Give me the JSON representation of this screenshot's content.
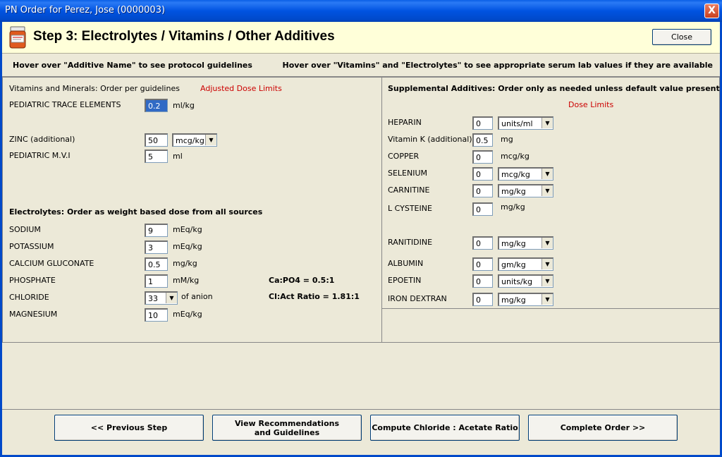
{
  "window": {
    "title": "PN Order for Perez, Jose (0000003)",
    "close_glyph": "X"
  },
  "header": {
    "step_title": "Step 3: Electrolytes / Vitamins / Other Additives",
    "close_label": "Close"
  },
  "hints": {
    "left": "Hover over \"Additive Name\" to see protocol guidelines",
    "right": "Hover over \"Vitamins\" and \"Electrolytes\" to see appropriate serum lab values if they are available"
  },
  "vitamins": {
    "heading": "Vitamins and Minerals: Order per guidelines",
    "limits_label": "Adjusted Dose Limits",
    "items": [
      {
        "name": "PEDIATRIC TRACE ELEMENTS",
        "value": "0.2",
        "unit": "ml/kg"
      },
      {
        "name": "ZINC (additional)",
        "value": "50",
        "unit": "mcg/kg"
      },
      {
        "name": "PEDIATRIC M.V.I",
        "value": "5",
        "unit": "ml"
      }
    ]
  },
  "electrolytes": {
    "heading": "Electrolytes: Order as weight based dose from all sources",
    "items": [
      {
        "name": "SODIUM",
        "value": "9",
        "unit": "mEq/kg"
      },
      {
        "name": "POTASSIUM",
        "value": "3",
        "unit": "mEq/kg"
      },
      {
        "name": "CALCIUM GLUCONATE",
        "value": "0.5",
        "unit": "mg/kg"
      },
      {
        "name": "PHOSPHATE",
        "value": "1",
        "unit": "mM/kg"
      },
      {
        "name": "CHLORIDE",
        "value": "33",
        "unit": "of anion"
      },
      {
        "name": "MAGNESIUM",
        "value": "10",
        "unit": "mEq/kg"
      }
    ],
    "ca_po4": "Ca:PO4 = 0.5:1",
    "cl_act": "Cl:Act Ratio = 1.81:1"
  },
  "supplemental": {
    "heading": "Supplemental Additives: Order only as needed unless default value present",
    "limits_label": "Dose Limits",
    "items": [
      {
        "name": "HEPARIN",
        "value": "0",
        "unit": "units/ml"
      },
      {
        "name": "Vitamin K (additional)",
        "value": "0.5",
        "unit": "mg"
      },
      {
        "name": "COPPER",
        "value": "0",
        "unit": "mcg/kg"
      },
      {
        "name": "SELENIUM",
        "value": "0",
        "unit": "mcg/kg"
      },
      {
        "name": "CARNITINE",
        "value": "0",
        "unit": "mg/kg"
      },
      {
        "name": "L CYSTEINE",
        "value": "0",
        "unit": "mg/kg"
      },
      {
        "name": "RANITIDINE",
        "value": "0",
        "unit": "mg/kg"
      },
      {
        "name": "ALBUMIN",
        "value": "0",
        "unit": "gm/kg"
      },
      {
        "name": "EPOETIN",
        "value": "0",
        "unit": "units/kg"
      },
      {
        "name": "IRON DEXTRAN",
        "value": "0",
        "unit": "mg/kg"
      }
    ]
  },
  "footer": {
    "prev": "<< Previous Step",
    "view": "View Recommendations and Guidelines",
    "compute": "Compute Chloride : Acetate Ratio",
    "complete": "Complete Order >>"
  },
  "colors": {
    "titlebar": "#0053e1",
    "header_bg": "#ffffd9",
    "limits_red": "#cc0000"
  },
  "icons": {
    "header": "medicine-bottle-icon",
    "dropdown": "chevron-down-icon"
  }
}
